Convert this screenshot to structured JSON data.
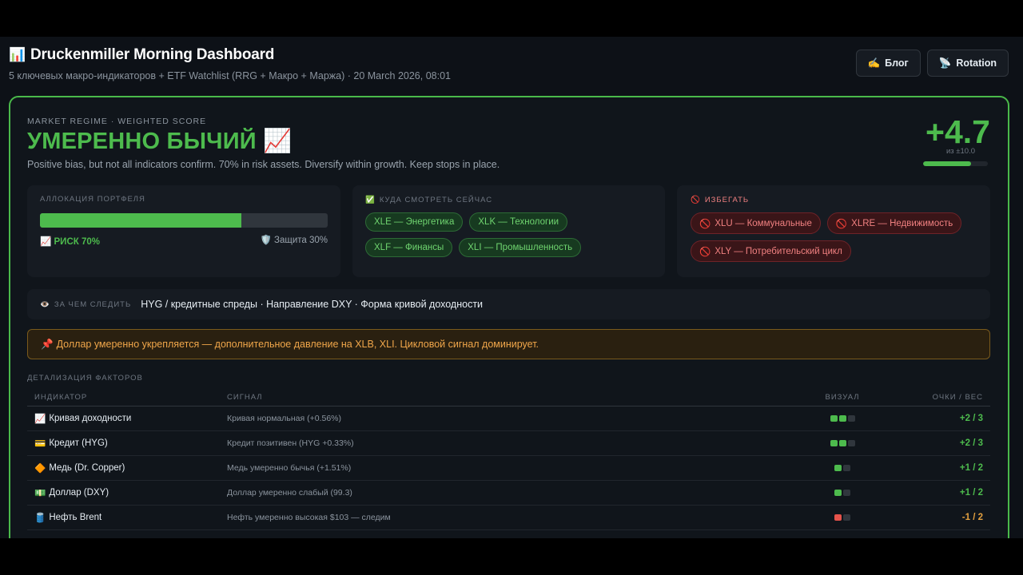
{
  "header": {
    "icon": "bar-chart-icon",
    "title": "Druckenmiller Morning Dashboard",
    "subtitle": "5 ключевых макро-индикаторов + ETF Watchlist (RRG + Макро + Маржа) · 20 March 2026, 08:01",
    "buttons": [
      {
        "icon": "✍️",
        "label": "Блог"
      },
      {
        "icon": "📡",
        "label": "Rotation"
      }
    ]
  },
  "regime": {
    "label": "MARKET REGIME · WEIGHTED SCORE",
    "title": "УМЕРЕННО БЫЧИЙ 📈",
    "description": "Positive bias, but not all indicators confirm. 70% in risk assets. Diversify within growth. Keep stops in place.",
    "score": "+4.7",
    "score_sub": "из ±10.0",
    "score_fraction": 0.735
  },
  "allocation": {
    "label": "АЛЛОКАЦИЯ ПОРТФЕЛЯ",
    "risk_fraction": 0.7,
    "risk_label": "📈 РИСК 70%",
    "protect_label": "🛡️ Защита 30%"
  },
  "watch": {
    "icon": "✅",
    "label": "КУДА СМОТРЕТЬ СЕЙЧАС",
    "items": [
      "XLE — Энергетика",
      "XLK — Технологии",
      "XLF — Финансы",
      "XLI — Промышленность"
    ]
  },
  "avoid": {
    "icon": "🚫",
    "label": "ИЗБЕГАТЬ",
    "item_icon": "🚫",
    "items": [
      "XLU — Коммунальные",
      "XLRE — Недвижимость",
      "XLY — Потребительский цикл"
    ]
  },
  "watchline": {
    "icon": "👁️",
    "label": "ЗА ЧЕМ СЛЕДИТЬ",
    "text": "HYG / кредитные спреды · Направление DXY · Форма кривой доходности"
  },
  "alert": {
    "icon": "📌",
    "text": "Доллар умеренно укрепляется — дополнительное давление на XLB, XLI. Цикловой сигнал доминирует."
  },
  "factors": {
    "label": "ДЕТАЛИЗАЦИЯ ФАКТОРОВ",
    "columns": [
      "ИНДИКАТОР",
      "СИГНАЛ",
      "ВИЗУАЛ",
      "ОЧКИ / ВЕС"
    ],
    "rows": [
      {
        "icon": "📈",
        "name": "Кривая доходности",
        "signal": "Кривая нормальная (+0.56%)",
        "visual": [
          "g",
          "g",
          "e"
        ],
        "points": "+2 / 3",
        "sign": "pos"
      },
      {
        "icon": "💳",
        "name": "Кредит (HYG)",
        "signal": "Кредит позитивен (HYG +0.33%)",
        "visual": [
          "g",
          "g",
          "e"
        ],
        "points": "+2 / 3",
        "sign": "pos"
      },
      {
        "icon": "🔶",
        "name": "Медь (Dr. Copper)",
        "signal": "Медь умеренно бычья (+1.51%)",
        "visual": [
          "g",
          "e"
        ],
        "points": "+1 / 2",
        "sign": "pos"
      },
      {
        "icon": "💵",
        "name": "Доллар (DXY)",
        "signal": "Доллар умеренно слабый (99.3)",
        "visual": [
          "g",
          "e"
        ],
        "points": "+1 / 2",
        "sign": "pos"
      },
      {
        "icon": "🛢️",
        "name": "Нефть Brent",
        "signal": "Нефть умеренно высокая $103 — следим",
        "visual": [
          "r",
          "e"
        ],
        "points": "-1 / 2",
        "sign": "neg"
      }
    ]
  }
}
